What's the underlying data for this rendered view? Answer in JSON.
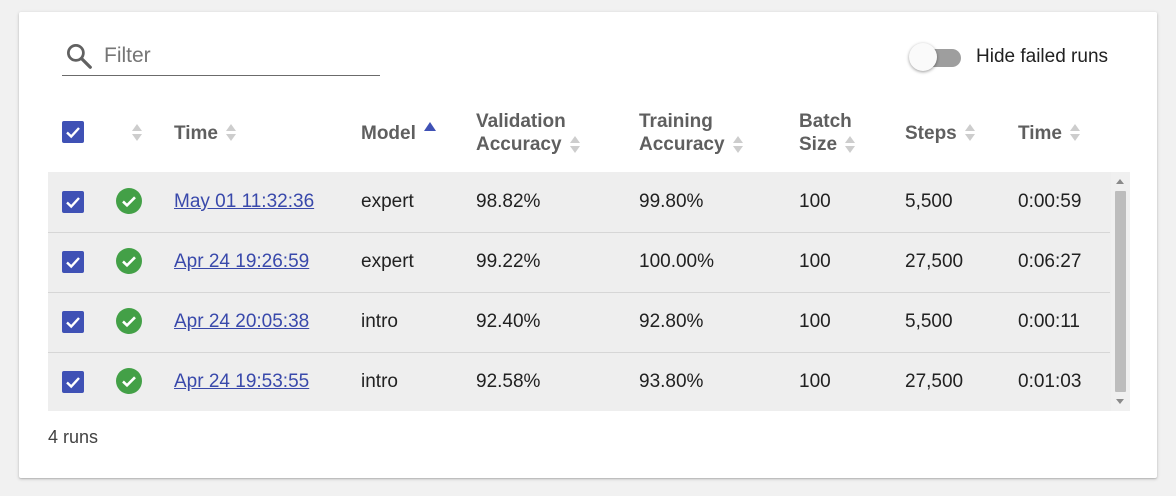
{
  "filter": {
    "placeholder": "Filter",
    "value": ""
  },
  "toggle": {
    "label": "Hide failed runs",
    "on": false
  },
  "header": {
    "time": "Time",
    "model": "Model",
    "validation_accuracy_line1": "Validation",
    "validation_accuracy_line2": "Accuracy",
    "training_accuracy_line1": "Training",
    "training_accuracy_line2": "Accuracy",
    "batch_size_line1": "Batch",
    "batch_size_line2": "Size",
    "steps": "Steps",
    "duration": "Time"
  },
  "rows": [
    {
      "time": "May 01 11:32:36",
      "model": "expert",
      "val_acc": "98.82%",
      "train_acc": "99.80%",
      "batch": "100",
      "steps": "5,500",
      "duration": "0:00:59",
      "status": "success"
    },
    {
      "time": "Apr 24 19:26:59",
      "model": "expert",
      "val_acc": "99.22%",
      "train_acc": "100.00%",
      "batch": "100",
      "steps": "27,500",
      "duration": "0:06:27",
      "status": "success"
    },
    {
      "time": "Apr 24 20:05:38",
      "model": "intro",
      "val_acc": "92.40%",
      "train_acc": "92.80%",
      "batch": "100",
      "steps": "5,500",
      "duration": "0:00:11",
      "status": "success"
    },
    {
      "time": "Apr 24 19:53:55",
      "model": "intro",
      "val_acc": "92.58%",
      "train_acc": "93.80%",
      "batch": "100",
      "steps": "27,500",
      "duration": "0:01:03",
      "status": "success"
    }
  ],
  "footer": {
    "count": "4 runs"
  },
  "colors": {
    "accent": "#3f51b5",
    "success": "#43a047",
    "link": "#3949ab",
    "row_bg": "#eeeeee"
  }
}
